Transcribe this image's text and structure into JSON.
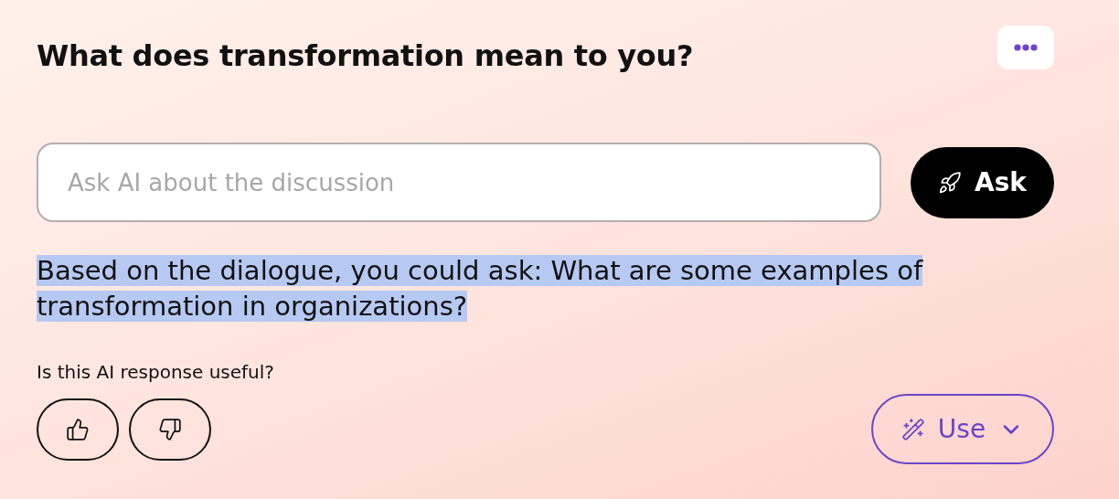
{
  "title": "What does transformation mean to you?",
  "ask_field": {
    "placeholder": "Ask AI about the discussion"
  },
  "ask_button": {
    "label": "Ask"
  },
  "response": {
    "text": "Based on the dialogue, you could ask: What are some examples of transformation in organizations?",
    "highlighted": true
  },
  "feedback": {
    "question": "Is this AI response useful?"
  },
  "use_button": {
    "label": "Use"
  }
}
